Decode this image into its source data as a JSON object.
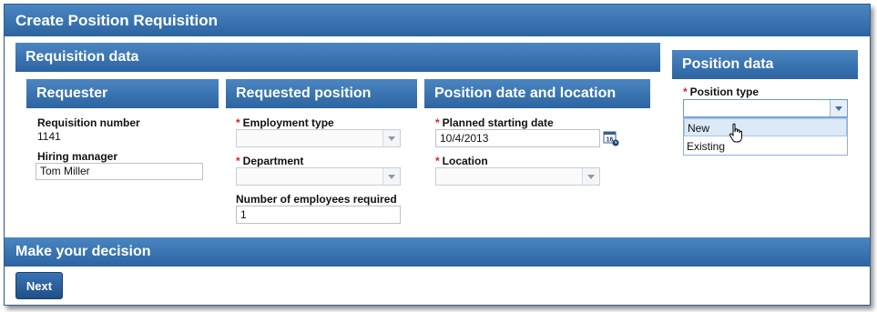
{
  "header": {
    "title": "Create Position Requisition"
  },
  "requisition_section": {
    "title": "Requisition data"
  },
  "requester": {
    "title": "Requester",
    "requisition_number_label": "Requisition number",
    "requisition_number_value": "1141",
    "hiring_manager_label": "Hiring manager",
    "hiring_manager_value": "Tom Miller"
  },
  "requested_position": {
    "title": "Requested position",
    "required_marker": "*",
    "employment_type_label": "Employment type",
    "employment_type_value": "",
    "department_label": "Department",
    "department_value": "",
    "num_employees_label": "Number of employees required",
    "num_employees_value": "1"
  },
  "position_date_location": {
    "title": "Position date and location",
    "required_marker": "*",
    "start_date_label": "Planned starting date",
    "start_date_value": "10/4/2013",
    "calendar_icon": "calendar-icon",
    "calendar_day": "16",
    "location_label": "Location",
    "location_value": ""
  },
  "position_data": {
    "title": "Position data",
    "required_marker": "*",
    "position_type_label": "Position type",
    "position_type_value": "",
    "options": [
      "New",
      "Existing"
    ]
  },
  "decision": {
    "title": "Make your decision",
    "next_label": "Next"
  },
  "colors": {
    "bar_top": "#4a86c2",
    "bar_bottom": "#2c64a0",
    "required": "#dd2222"
  }
}
